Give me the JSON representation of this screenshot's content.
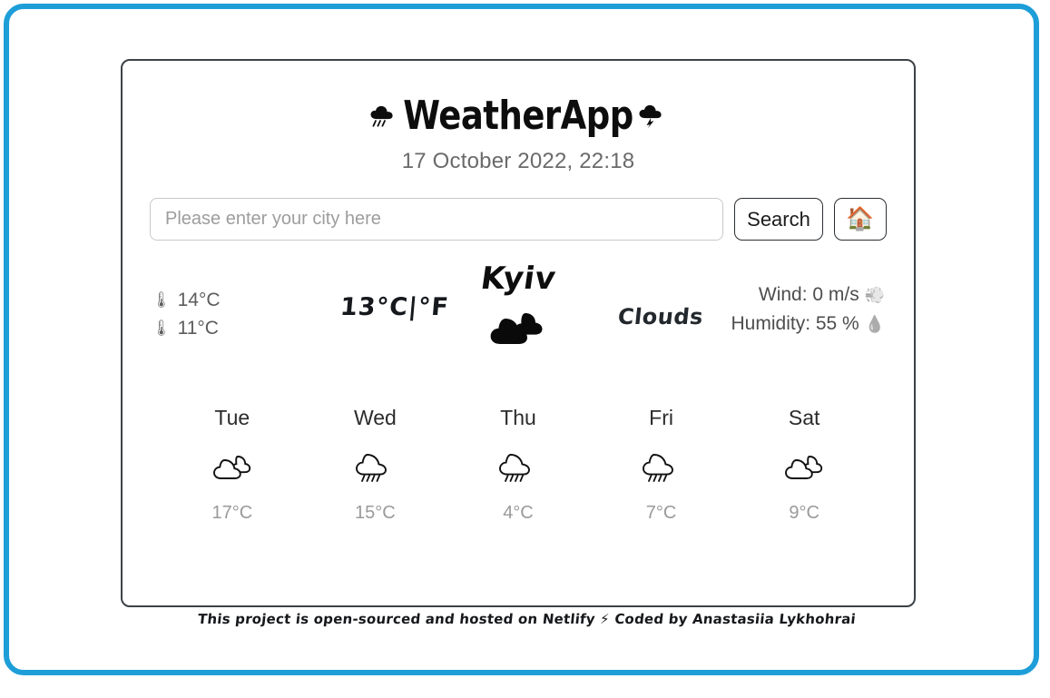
{
  "theme": {
    "frame_border_color": "#1d9ed8",
    "card_border_color": "#3b4248",
    "text_color": "#2c2c2c",
    "muted_text_color": "#9a9a9a"
  },
  "header": {
    "title": "WeatherApp",
    "left_icon": "rain-cloud-icon",
    "right_icon": "storm-cloud-icon",
    "date": "17 October 2022, 22:18"
  },
  "search": {
    "placeholder": "Please enter your city here",
    "value": "",
    "search_label": "Search",
    "home_icon": "🏠"
  },
  "current": {
    "max_temp": "14°C",
    "min_temp": "11°C",
    "thermo_icon": "🌡",
    "temperature": "13",
    "degree": "°",
    "unit_celsius": "C",
    "unit_separator": "|",
    "unit_fahrenheit": "°F",
    "city": "Kyiv",
    "condition": "Clouds",
    "icon": "broken-clouds-icon",
    "wind": "Wind: 0 m/s",
    "wind_icon": "💨",
    "humidity": "Humidity: 55 %",
    "humidity_icon": "💧"
  },
  "forecast": [
    {
      "day": "Tue",
      "icon": "few-clouds-icon",
      "temp": "17°C"
    },
    {
      "day": "Wed",
      "icon": "rain-icon",
      "temp": "15°C"
    },
    {
      "day": "Thu",
      "icon": "rain-icon",
      "temp": "4°C"
    },
    {
      "day": "Fri",
      "icon": "rain-icon",
      "temp": "7°C"
    },
    {
      "day": "Sat",
      "icon": "few-clouds-icon",
      "temp": "9°C"
    }
  ],
  "footer": {
    "text_before": "This project is open-sourced and hosted on",
    "link_label": "Netlify",
    "bolt": "⚡",
    "text_after": "Coded by Anastasiia Lykhohrai"
  }
}
